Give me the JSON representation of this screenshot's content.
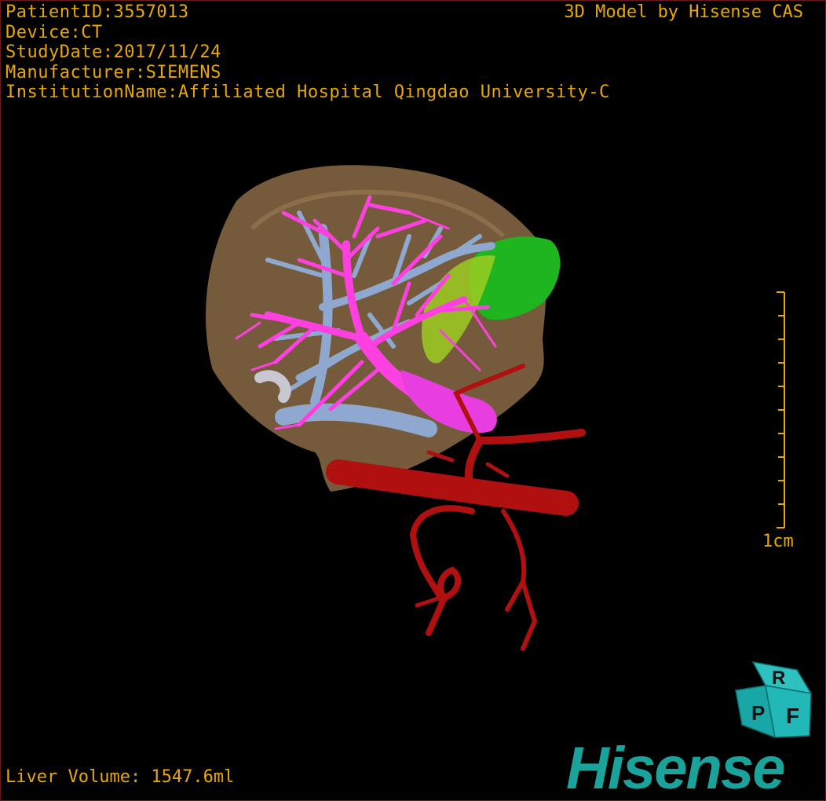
{
  "metadata": {
    "patient_id": "PatientID:3557013",
    "device": "Device:CT",
    "study_date": "StudyDate:2017/11/24",
    "manufacturer": "Manufacturer:SIEMENS",
    "institution": "InstitutionName:Affiliated Hospital Qingdao University-C"
  },
  "credit": "3D Model by Hisense CAS",
  "liver_volume": "Liver Volume: 1547.6ml",
  "scale_bar": {
    "label": "1cm"
  },
  "orientation_cube": {
    "faces": [
      "P",
      "R",
      "F"
    ]
  },
  "brand": "Hisense",
  "colors": {
    "overlay_text": "#e8a800",
    "liver": "#8a6a45",
    "portal_vein": "#ff40e0",
    "hepatic_vein": "#8fa8d0",
    "gallbladder": "#22b822",
    "artery": "#b01010",
    "brand": "#1aa39b"
  }
}
